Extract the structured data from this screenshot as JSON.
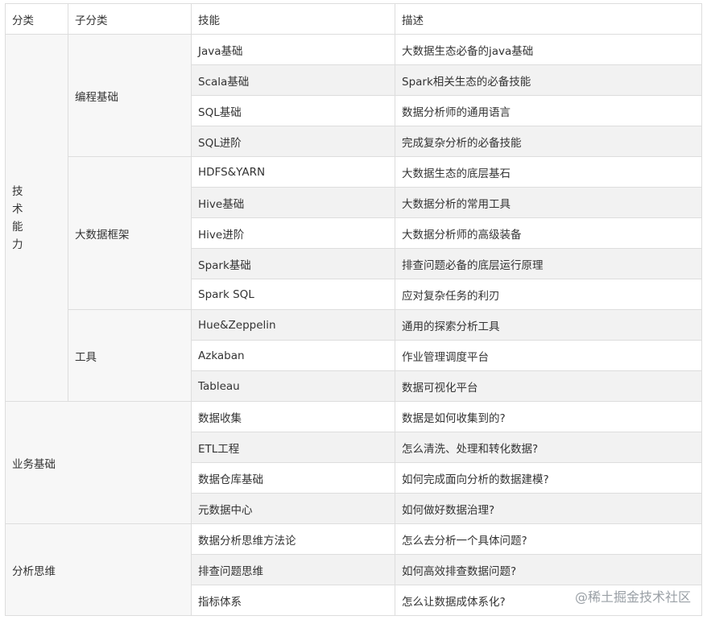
{
  "headers": [
    "分类",
    "子分类",
    "技能",
    "描述"
  ],
  "category_tech_chars": [
    "技",
    "术",
    "能",
    "力"
  ],
  "subcategories": {
    "programming": "编程基础",
    "bigdata": "大数据框架",
    "tools": "工具"
  },
  "categories": {
    "business": "业务基础",
    "thinking": "分析思维"
  },
  "rows": [
    {
      "skill": "Java基础",
      "desc": "大数据生态必备的java基础"
    },
    {
      "skill": "Scala基础",
      "desc": "Spark相关生态的必备技能"
    },
    {
      "skill": "SQL基础",
      "desc": "数据分析师的通用语言"
    },
    {
      "skill": "SQL进阶",
      "desc": "完成复杂分析的必备技能"
    },
    {
      "skill": "HDFS&YARN",
      "desc": "大数据生态的底层基石"
    },
    {
      "skill": "Hive基础",
      "desc": "大数据分析的常用工具"
    },
    {
      "skill": "Hive进阶",
      "desc": "大数据分析师的高级装备"
    },
    {
      "skill": "Spark基础",
      "desc": "排查问题必备的底层运行原理"
    },
    {
      "skill": "Spark SQL",
      "desc": "应对复杂任务的利刃"
    },
    {
      "skill": "Hue&Zeppelin",
      "desc": "通用的探索分析工具"
    },
    {
      "skill": "Azkaban",
      "desc": "作业管理调度平台"
    },
    {
      "skill": "Tableau",
      "desc": "数据可视化平台"
    },
    {
      "skill": "数据收集",
      "desc": "数据是如何收集到的?"
    },
    {
      "skill": "ETL工程",
      "desc": "怎么清洗、处理和转化数据?"
    },
    {
      "skill": "数据仓库基础",
      "desc": "如何完成面向分析的数据建模?"
    },
    {
      "skill": "元数据中心",
      "desc": "如何做好数据治理?"
    },
    {
      "skill": "数据分析思维方法论",
      "desc": "怎么去分析一个具体问题?"
    },
    {
      "skill": "排查问题思维",
      "desc": "如何高效排查数据问题?"
    },
    {
      "skill": "指标体系",
      "desc": "怎么让数据成体系化?"
    }
  ],
  "watermark": "@稀土掘金技术社区"
}
